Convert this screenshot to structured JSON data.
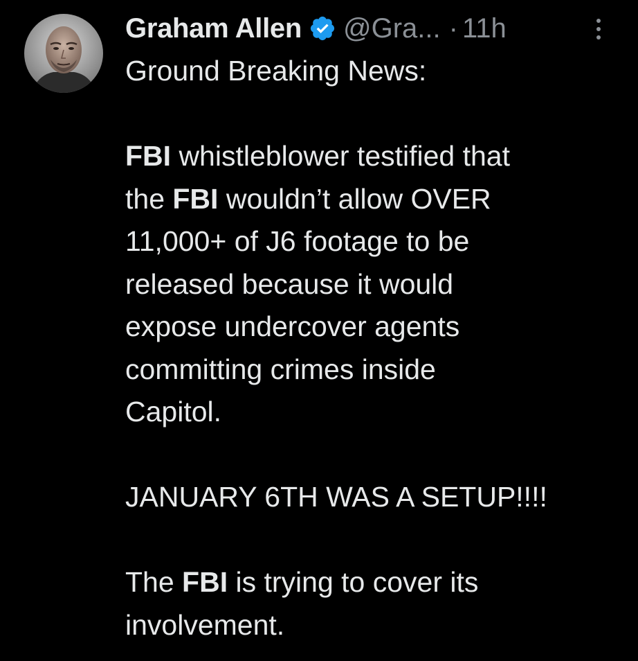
{
  "author": {
    "display_name": "Graham Allen",
    "handle": "@Gra...",
    "separator": "·",
    "time": "11h",
    "avatar_icon": "user-avatar",
    "verified_icon": "verified-badge-icon",
    "verified_color": "#1d9bf0"
  },
  "menu": {
    "icon": "more-vertical-icon"
  },
  "post": {
    "intro": "Ground Breaking News:",
    "p1_l1_bold": "FBI",
    "p1_l1_rest": " whistleblower testified that",
    "p1_l2_pre": "the ",
    "p1_l2_bold": "FBI",
    "p1_l2_rest": " wouldn’t allow OVER",
    "p1_l3": "11,000+ of J6 footage to be",
    "p1_l4": "released because it would",
    "p1_l5": "expose undercover agents",
    "p1_l6": "committing crimes inside",
    "p1_l7": "Capitol.",
    "p2": "JANUARY 6TH WAS A SETUP!!!!",
    "p3_l1_pre": "The ",
    "p3_l1_bold": "FBI",
    "p3_l1_rest": " is trying to cover its",
    "p3_l2": "involvement."
  },
  "colors": {
    "background": "#000000",
    "text": "#e7e9ea",
    "muted": "#8b9096"
  }
}
